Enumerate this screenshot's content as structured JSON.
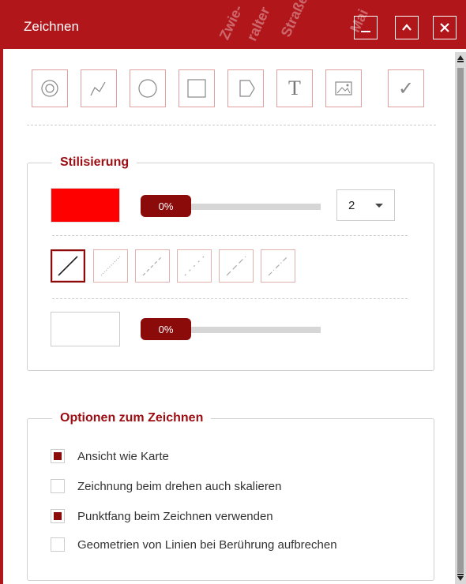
{
  "window": {
    "title": "Zeichnen",
    "minimize_label": "_",
    "maximize_label": "^",
    "close_label": "✕",
    "accent_color": "#b1161b"
  },
  "toolbar": {
    "tools": [
      {
        "name": "point-tool",
        "icon": "point-icon"
      },
      {
        "name": "polyline-tool",
        "icon": "polyline-icon"
      },
      {
        "name": "circle-tool",
        "icon": "circle-icon"
      },
      {
        "name": "rectangle-tool",
        "icon": "rectangle-icon"
      },
      {
        "name": "polygon-tool",
        "icon": "polygon-icon"
      },
      {
        "name": "text-tool",
        "icon": "text-icon",
        "glyph": "T"
      },
      {
        "name": "image-tool",
        "icon": "image-icon"
      },
      {
        "name": "confirm-tool",
        "icon": "checkmark-icon",
        "glyph": "✓"
      }
    ]
  },
  "styling": {
    "legend": "Stilisierung",
    "stroke_color": "#ff0000",
    "stroke_opacity_label": "0%",
    "stroke_opacity": 0,
    "stroke_width_value": "2",
    "line_styles": [
      "solid",
      "dotted",
      "dashed",
      "dash-dot-sparse",
      "long-dash",
      "dash-dot"
    ],
    "active_line_style": "solid",
    "fill_color": "#ffffff",
    "fill_opacity_label": "0%",
    "fill_opacity": 0
  },
  "options": {
    "legend": "Optionen zum Zeichnen",
    "items": [
      {
        "label": "Ansicht wie Karte",
        "checked": true
      },
      {
        "label": "Zeichnung beim drehen auch skalieren",
        "checked": false
      },
      {
        "label": "Punktfang beim Zeichnen verwenden",
        "checked": true
      },
      {
        "label": "Geometrien von Linien bei Berührung aufbrechen",
        "checked": false
      }
    ]
  },
  "background_map": {
    "labels": [
      "Zwie-",
      "ralter",
      "Straße",
      "Mai"
    ]
  }
}
